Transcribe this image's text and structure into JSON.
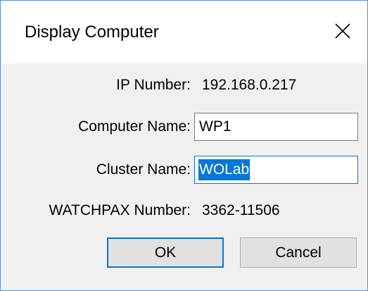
{
  "window": {
    "title": "Display Computer",
    "close_icon": "close-icon"
  },
  "fields": {
    "ip": {
      "label": "IP Number:",
      "value": "192.168.0.217"
    },
    "computer_name": {
      "label": "Computer Name:",
      "value": "WP1"
    },
    "cluster_name": {
      "label": "Cluster Name:",
      "value": "WOLab",
      "selected": true
    },
    "watchpax": {
      "label": "WATCHPAX Number:",
      "value": "3362-11506"
    }
  },
  "buttons": {
    "ok_label": "OK",
    "cancel_label": "Cancel"
  },
  "colors": {
    "accent": "#0078d7",
    "dialog_bg": "#f0f0f0",
    "border": "#5b8fd6"
  }
}
